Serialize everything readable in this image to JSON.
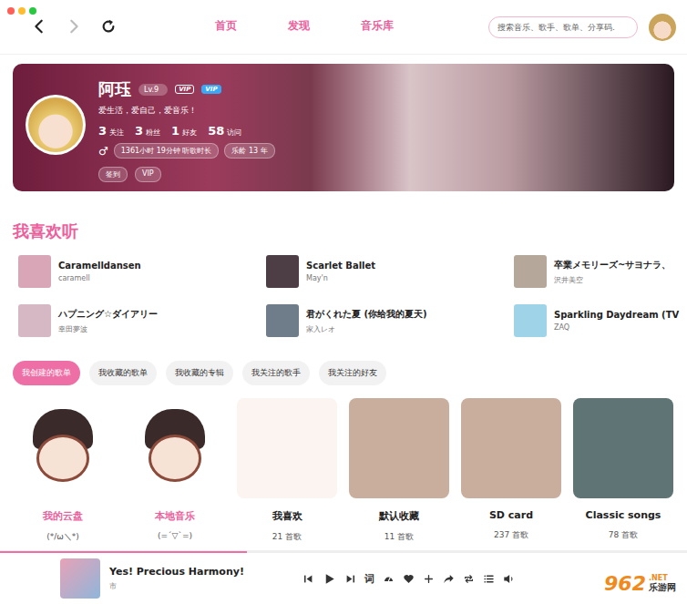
{
  "history": {
    "back_disabled": false,
    "forward_disabled": true
  },
  "nav": {
    "links": [
      "首页",
      "发现",
      "音乐库"
    ]
  },
  "search": {
    "placeholder": "搜索音乐、歌手、歌单、分享码."
  },
  "profile": {
    "name": "阿珏",
    "level": "Lv.9",
    "vip_badges": [
      "VIP",
      "VIP"
    ],
    "bio": "爱生活，爱自己，爱音乐！",
    "stats": [
      {
        "value": "3",
        "label": "关注"
      },
      {
        "value": "3",
        "label": "粉丝"
      },
      {
        "value": "1",
        "label": "好友"
      },
      {
        "value": "58",
        "label": "访问"
      }
    ],
    "gender": "♂",
    "listen_time": "1361小时 19分钟 听歌时长",
    "music_age": "乐龄 13 年",
    "buttons": [
      "签到",
      "VIP"
    ]
  },
  "liked": {
    "title": "我喜欢听",
    "songs": [
      {
        "title": "Caramelldansen",
        "artist": "caramell"
      },
      {
        "title": "Scarlet Ballet",
        "artist": "May'n"
      },
      {
        "title": "卒業メモリーズ~サヨナラ、",
        "artist": "沢井美空"
      },
      {
        "title": "ハプニング☆ダイアリー",
        "artist": "幸田夢波"
      },
      {
        "title": "君がくれた夏 (你给我的夏天)",
        "artist": "家入レオ"
      },
      {
        "title": "Sparkling Daydream (TV",
        "artist": "ZAQ"
      }
    ]
  },
  "tabs": [
    {
      "label": "我创建的歌单",
      "selected": true
    },
    {
      "label": "我收藏的歌单",
      "selected": false
    },
    {
      "label": "我收藏的专辑",
      "selected": false
    },
    {
      "label": "我关注的歌手",
      "selected": false
    },
    {
      "label": "我关注的好友",
      "selected": false
    }
  ],
  "playlists": [
    {
      "title": "我的云盘",
      "subtitle": "(*/ω＼*)",
      "kind": "special"
    },
    {
      "title": "本地音乐",
      "subtitle": "(=´▽`=)",
      "kind": "special"
    },
    {
      "title": "我喜欢",
      "subtitle": "21 首歌",
      "kind": "playlist"
    },
    {
      "title": "默认收藏",
      "subtitle": "11 首歌",
      "kind": "playlist"
    },
    {
      "title": "SD card",
      "subtitle": "237 首歌",
      "kind": "playlist"
    },
    {
      "title": "Classic songs",
      "subtitle": "78 首歌",
      "kind": "playlist"
    }
  ],
  "player": {
    "title": "Yes! Precious Harmony!",
    "artist": "市",
    "progress": 0.36,
    "lyrics_button": "词"
  },
  "watermark": {
    "number": "962",
    "domain": ".NET",
    "name": "乐游网"
  }
}
